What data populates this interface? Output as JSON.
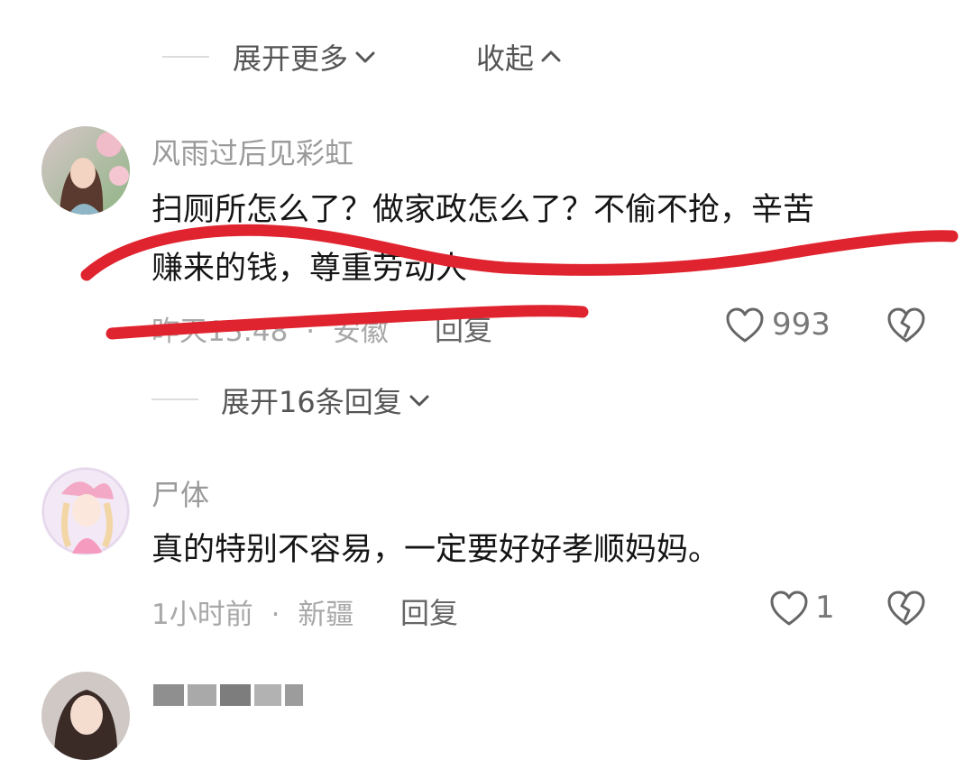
{
  "top_actions": {
    "expand_more": "展开更多",
    "collapse": "收起"
  },
  "comments": [
    {
      "username": "风雨过后见彩虹",
      "text_line1": "扫厕所怎么了？做家政怎么了？不偷不抢，辛苦",
      "text_line2": "赚来的钱，尊重劳动人",
      "time": "昨天13:48",
      "sep": "·",
      "location": "安徽",
      "reply": "回复",
      "likes": "993",
      "expand_replies": "展开16条回复"
    },
    {
      "username": "尸体",
      "text": "真的特别不容易，一定要好好孝顺妈妈。",
      "time": "1小时前",
      "sep": "·",
      "location": "新疆",
      "reply": "回复",
      "likes": "1"
    }
  ],
  "colors": {
    "scribble": "#e0242f"
  }
}
